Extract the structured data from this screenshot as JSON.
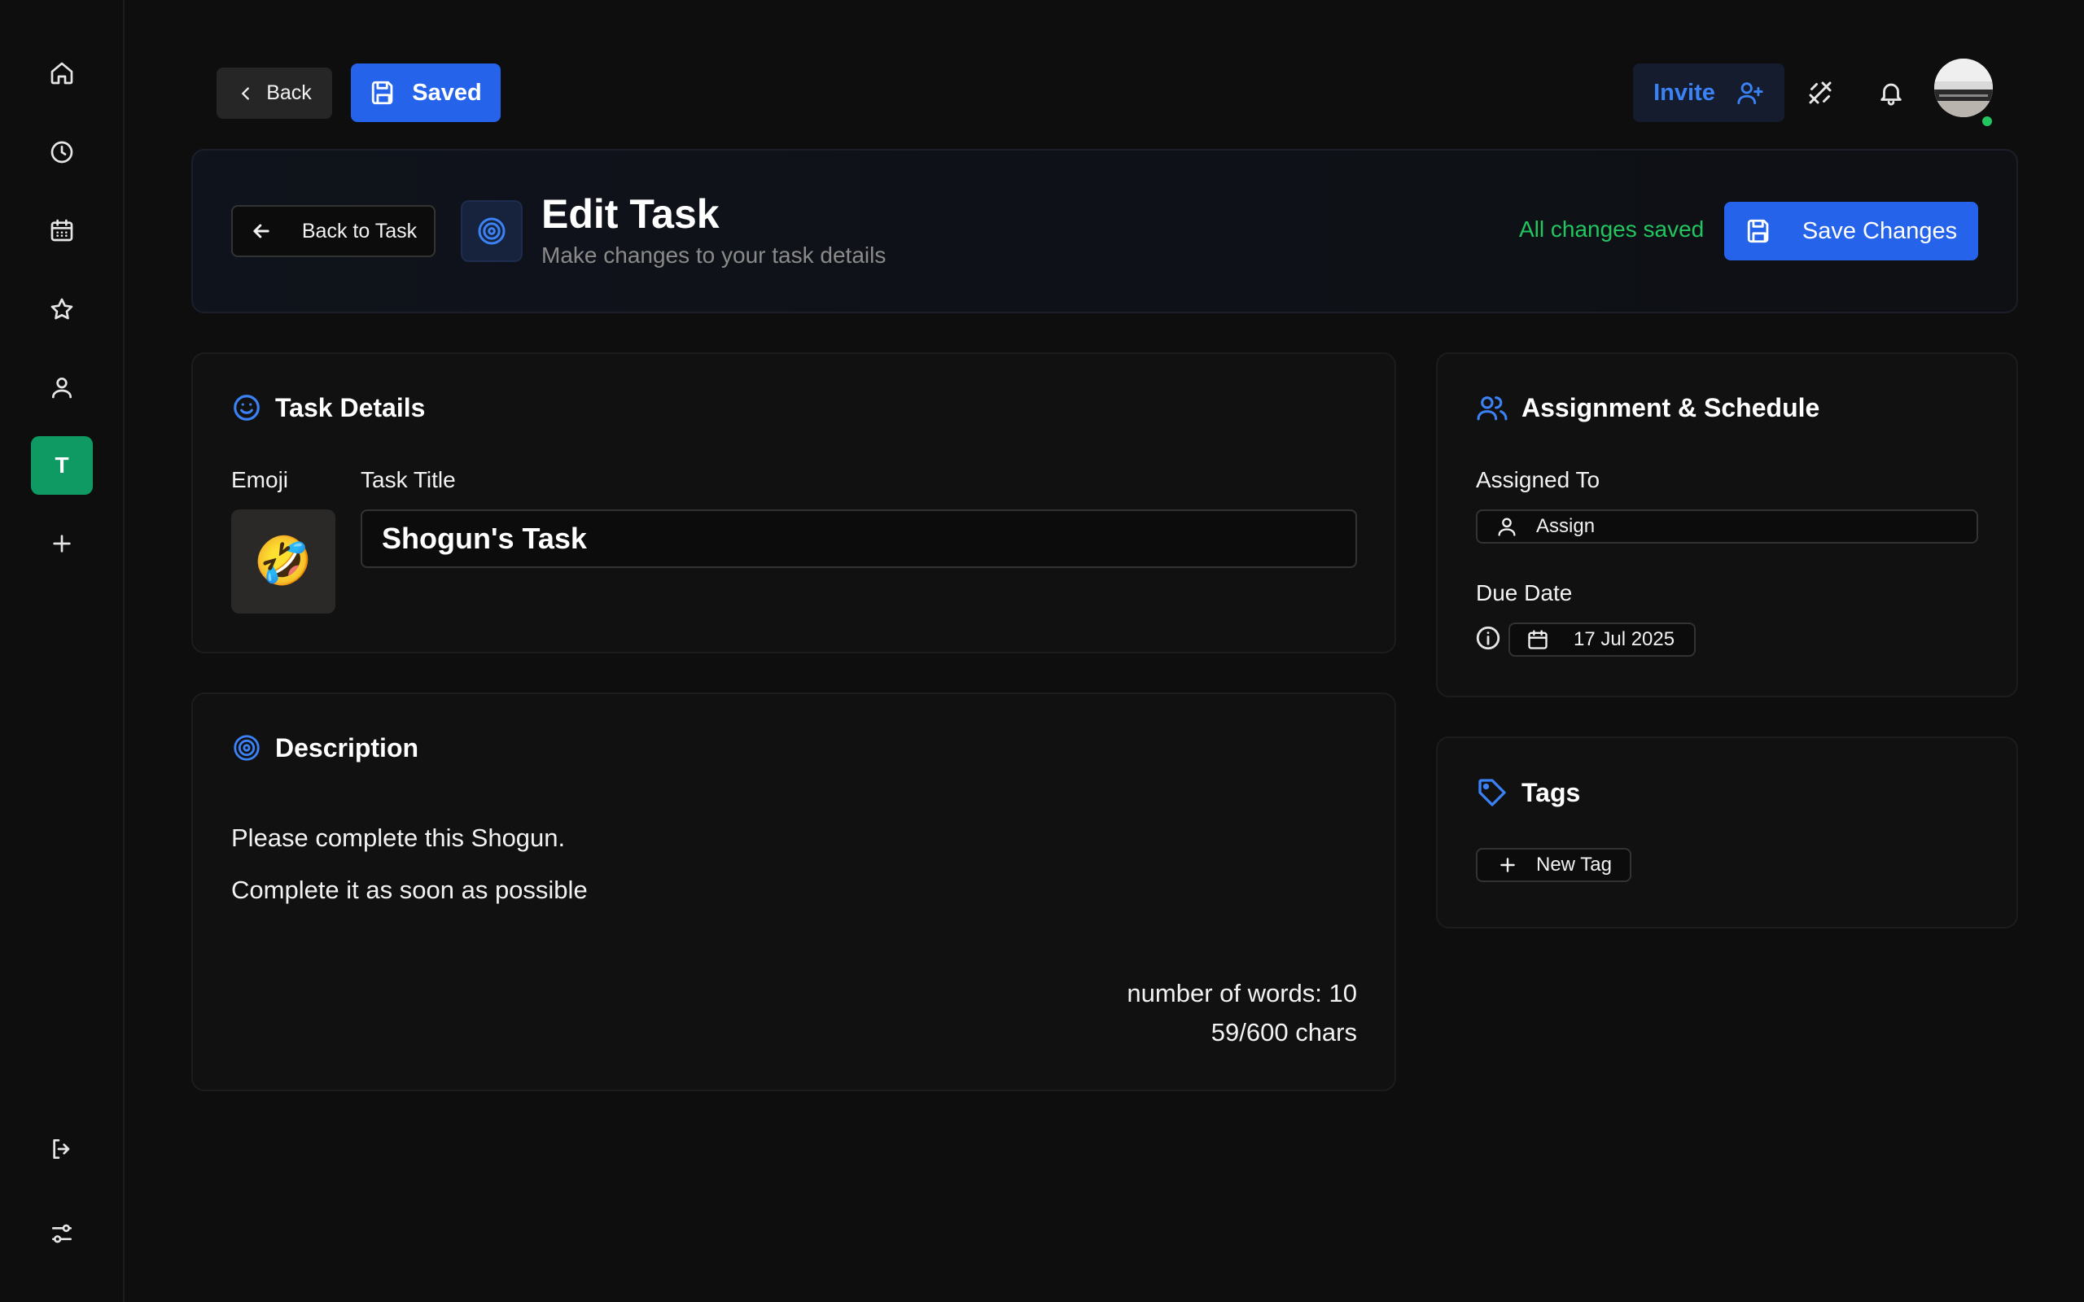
{
  "sidebar": {
    "items": [
      {
        "name": "home-icon"
      },
      {
        "name": "clock-icon"
      },
      {
        "name": "calendar-icon"
      },
      {
        "name": "star-icon"
      },
      {
        "name": "user-icon"
      },
      {
        "name": "workspace",
        "label": "T"
      },
      {
        "name": "plus-icon"
      }
    ],
    "bottom": [
      {
        "name": "logout-icon"
      },
      {
        "name": "settings-sliders-icon"
      }
    ]
  },
  "topbar": {
    "back_label": "Back",
    "saved_label": "Saved",
    "invite_label": "Invite"
  },
  "header": {
    "back_to_task_label": "Back to Task",
    "title": "Edit Task",
    "subtitle": "Make changes to your task details",
    "status": "All changes saved",
    "save_label": "Save Changes"
  },
  "task_details": {
    "title": "Task Details",
    "emoji_label": "Emoji",
    "emoji": "🤣",
    "task_title_label": "Task Title",
    "task_title_value": "Shogun's Task"
  },
  "description": {
    "title": "Description",
    "lines": [
      "Please complete this Shogun.",
      "Complete it as soon as possible"
    ],
    "word_count": "number of words: 10",
    "char_count": "59/600 chars"
  },
  "assignment": {
    "title": "Assignment & Schedule",
    "assigned_label": "Assigned To",
    "assign_button": "Assign",
    "due_label": "Due Date",
    "due_value": "17 Jul 2025"
  },
  "tags": {
    "title": "Tags",
    "new_tag_label": "New Tag"
  },
  "colors": {
    "accent": "#2563eb",
    "success": "#22c55e",
    "workspace": "#0f9a64",
    "background": "#0e0e0e"
  }
}
